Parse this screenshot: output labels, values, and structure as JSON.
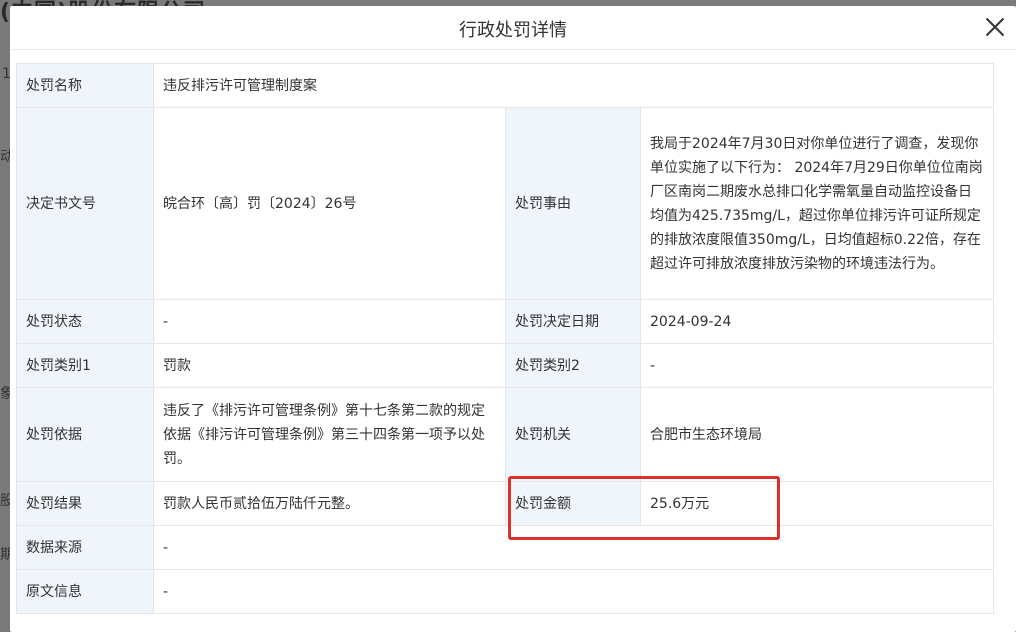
{
  "background": {
    "title": "(中国)股份有限公司",
    "side_glyphs": [
      "1",
      "动",
      "象",
      "股",
      "期"
    ]
  },
  "modal": {
    "title": "行政处罚详情",
    "close_label": "×"
  },
  "rows": {
    "name": {
      "label": "处罚名称",
      "value": "违反排污许可管理制度案"
    },
    "doc_no": {
      "label": "决定书文号",
      "value": "皖合环〔高〕罚〔2024〕26号"
    },
    "facts": {
      "label": "处罚事由",
      "value": "我局于2024年7月30日对你单位进行了调查，发现你单位实施了以下行为：  2024年7月29日你单位位南岗厂区南岗二期废水总排口化学需氧量自动监控设备日均值为425.735mg/L，超过你单位排污许可证所规定的排放浓度限值350mg/L，日均值超标0.22倍，存在超过许可排放浓度排放污染物的环境违法行为。"
    },
    "status": {
      "label": "处罚状态",
      "value": "-"
    },
    "decision_date": {
      "label": "处罚决定日期",
      "value": "2024-09-24"
    },
    "type1": {
      "label": "处罚类别1",
      "value": "罚款"
    },
    "type2": {
      "label": "处罚类别2",
      "value": "-"
    },
    "basis": {
      "label": "处罚依据",
      "value": "违反了《排污许可管理条例》第十七条第二款的规定依据《排污许可管理条例》第三十四条第一项予以处罚。"
    },
    "authority": {
      "label": "处罚机关",
      "value": "合肥市生态环境局"
    },
    "result": {
      "label": "处罚结果",
      "value": "罚款人民币贰拾伍万陆仟元整。"
    },
    "amount": {
      "label": "处罚金额",
      "value": "25.6万元"
    },
    "source": {
      "label": "数据来源",
      "value": "-"
    },
    "original": {
      "label": "原文信息",
      "value": "-"
    }
  },
  "colors": {
    "label_bg": "#f0f4fb",
    "border": "#e6e6e6",
    "highlight": "#d9312b"
  }
}
